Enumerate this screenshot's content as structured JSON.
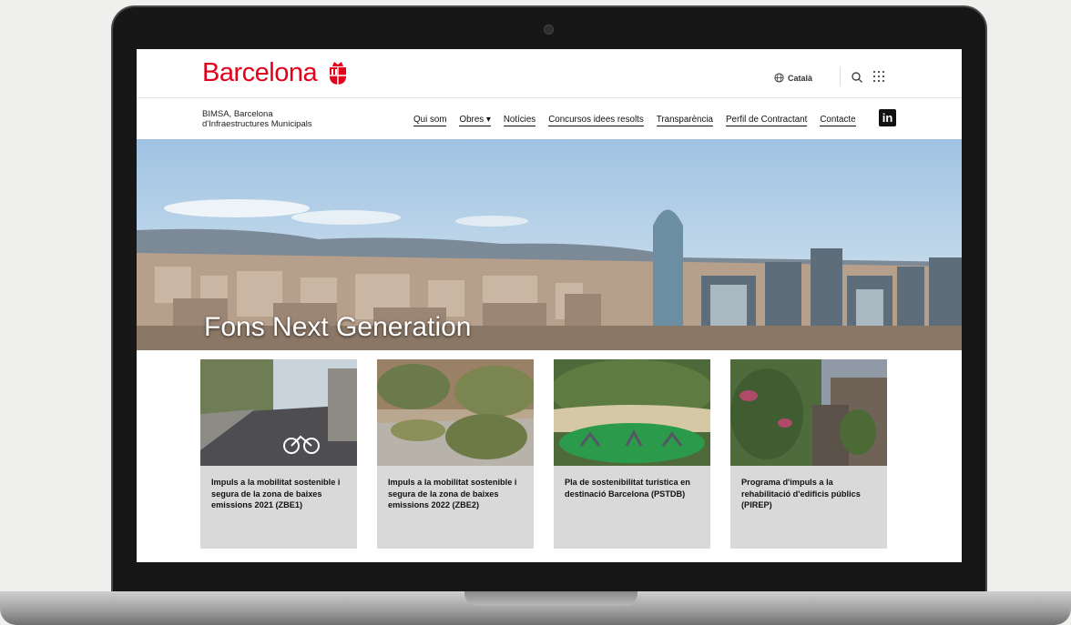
{
  "header": {
    "logo_text": "Barcelona",
    "language": "Català"
  },
  "navbar": {
    "org_line1": "BIMSA, Barcelona",
    "org_line2": "d'Infraestructures Municipals",
    "items": [
      {
        "label": "Qui som"
      },
      {
        "label": "Obres ▾"
      },
      {
        "label": "Notícies"
      },
      {
        "label": "Concursos idees resolts"
      },
      {
        "label": "Transparència"
      },
      {
        "label": "Perfil de Contractant"
      },
      {
        "label": "Contacte"
      }
    ],
    "linkedin_label": "in"
  },
  "hero": {
    "title": "Fons Next Generation"
  },
  "cards": [
    {
      "text": "Impuls a la mobilitat sostenible i segura de la zona de baixes emissions 2021 (ZBE1)"
    },
    {
      "text": "Impuls a la mobilitat sostenible i segura de la zona de baixes emissions 2022 (ZBE2)"
    },
    {
      "text": "Pla de sostenibilitat turística en destinació Barcelona (PSTDB)"
    },
    {
      "text": "Programa d'impuls a la rehabilitació d'edificis públics (PIREP)"
    }
  ],
  "colors": {
    "brand_red": "#e3001b",
    "card_bg": "#d9d9d9"
  },
  "icons": [
    "globe-icon",
    "search-icon",
    "apps-grid-icon",
    "linkedin-icon",
    "barcelona-emblem-icon"
  ]
}
